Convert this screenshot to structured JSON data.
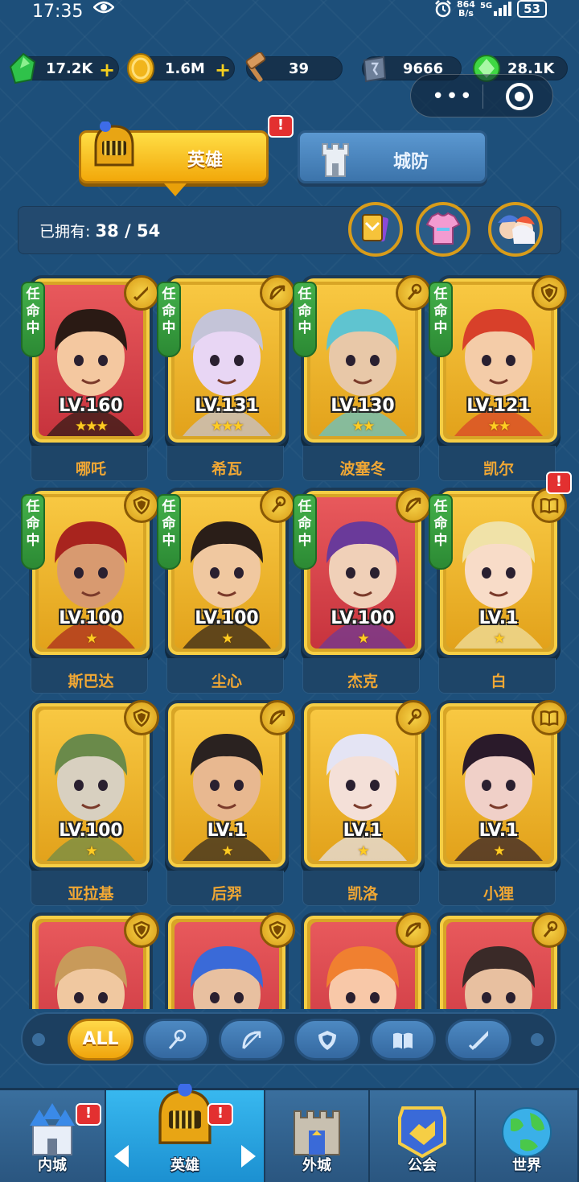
{
  "status_bar": {
    "time": "17:35",
    "net_speed_value": "864",
    "net_speed_unit": "B/s",
    "network": "5G",
    "battery": "53"
  },
  "resources": [
    {
      "name": "gem",
      "value": "17.2K",
      "has_plus": true,
      "icon": "green-gem-icon",
      "color": "#2fc24a"
    },
    {
      "name": "gold",
      "value": "1.6M",
      "has_plus": true,
      "icon": "gold-coin-icon",
      "color": "#f1b51c"
    },
    {
      "name": "hammer",
      "value": "39",
      "has_plus": false,
      "icon": "hammer-icon",
      "color": "#c98a4b"
    },
    {
      "name": "stone",
      "value": "9666",
      "has_plus": false,
      "icon": "rune-stone-icon",
      "color": "#6d7f99"
    },
    {
      "name": "crystal",
      "value": "28.1K",
      "has_plus": false,
      "icon": "green-crystal-icon",
      "color": "#3fd843"
    }
  ],
  "tabs": {
    "hero": "英雄",
    "wall": "城防"
  },
  "alert_mark": "!",
  "owned": {
    "label": "已拥有:",
    "count": "38 / 54"
  },
  "mission_label": "任命中",
  "heroes": [
    {
      "name": "哪吒",
      "level": "LV.160",
      "stars": 3,
      "bg": "red",
      "role": "sword-icon",
      "mission": true
    },
    {
      "name": "希瓦",
      "level": "LV.131",
      "stars": 3,
      "bg": "gold",
      "role": "bow-icon",
      "mission": true
    },
    {
      "name": "波塞冬",
      "level": "LV.130",
      "stars": 2,
      "bg": "gold",
      "role": "staff-icon",
      "mission": true
    },
    {
      "name": "凯尔",
      "level": "LV.121",
      "stars": 2,
      "bg": "gold",
      "role": "shield-icon",
      "mission": true
    },
    {
      "name": "斯巴达",
      "level": "LV.100",
      "stars": 1,
      "bg": "gold",
      "role": "shield-icon",
      "mission": true
    },
    {
      "name": "尘心",
      "level": "LV.100",
      "stars": 1,
      "bg": "gold",
      "role": "staff-icon",
      "mission": true
    },
    {
      "name": "杰克",
      "level": "LV.100",
      "stars": 1,
      "bg": "red",
      "role": "bow-icon",
      "mission": true
    },
    {
      "name": "白",
      "level": "LV.1",
      "stars": 1,
      "bg": "gold",
      "role": "book-icon",
      "mission": true,
      "alert": true
    },
    {
      "name": "亚拉基",
      "level": "LV.100",
      "stars": 1,
      "bg": "gold",
      "role": "shield-icon",
      "mission": false
    },
    {
      "name": "后羿",
      "level": "LV.1",
      "stars": 1,
      "bg": "gold",
      "role": "bow-icon",
      "mission": false
    },
    {
      "name": "凯洛",
      "level": "LV.1",
      "stars": 1,
      "bg": "gold",
      "role": "staff-icon",
      "mission": false
    },
    {
      "name": "小狸",
      "level": "LV.1",
      "stars": 1,
      "bg": "gold",
      "role": "book-icon",
      "mission": false
    },
    {
      "name": "",
      "level": "",
      "stars": 0,
      "bg": "red",
      "role": "shield-icon",
      "mission": false
    },
    {
      "name": "",
      "level": "",
      "stars": 0,
      "bg": "red",
      "role": "shield-icon",
      "mission": false
    },
    {
      "name": "",
      "level": "",
      "stars": 0,
      "bg": "red",
      "role": "bow-icon",
      "mission": false
    },
    {
      "name": "",
      "level": "",
      "stars": 0,
      "bg": "red",
      "role": "staff-icon",
      "mission": false
    }
  ],
  "filters": [
    {
      "label": "ALL",
      "icon": "",
      "active": true
    },
    {
      "label": "",
      "icon": "staff-icon",
      "active": false
    },
    {
      "label": "",
      "icon": "bow-icon",
      "active": false
    },
    {
      "label": "",
      "icon": "shield-icon",
      "active": false
    },
    {
      "label": "",
      "icon": "book-icon",
      "active": false
    },
    {
      "label": "",
      "icon": "sword-icon",
      "active": false
    }
  ],
  "nav": [
    {
      "label": "内城",
      "icon": "castle-icon",
      "active": false,
      "alert": true
    },
    {
      "label": "英雄",
      "icon": "hero-helmet-icon",
      "active": true,
      "alert": true
    },
    {
      "label": "外城",
      "icon": "fortress-icon",
      "active": false,
      "alert": false
    },
    {
      "label": "公会",
      "icon": "handshake-icon",
      "active": false,
      "alert": false
    },
    {
      "label": "世界",
      "icon": "globe-icon",
      "active": false,
      "alert": false
    }
  ]
}
